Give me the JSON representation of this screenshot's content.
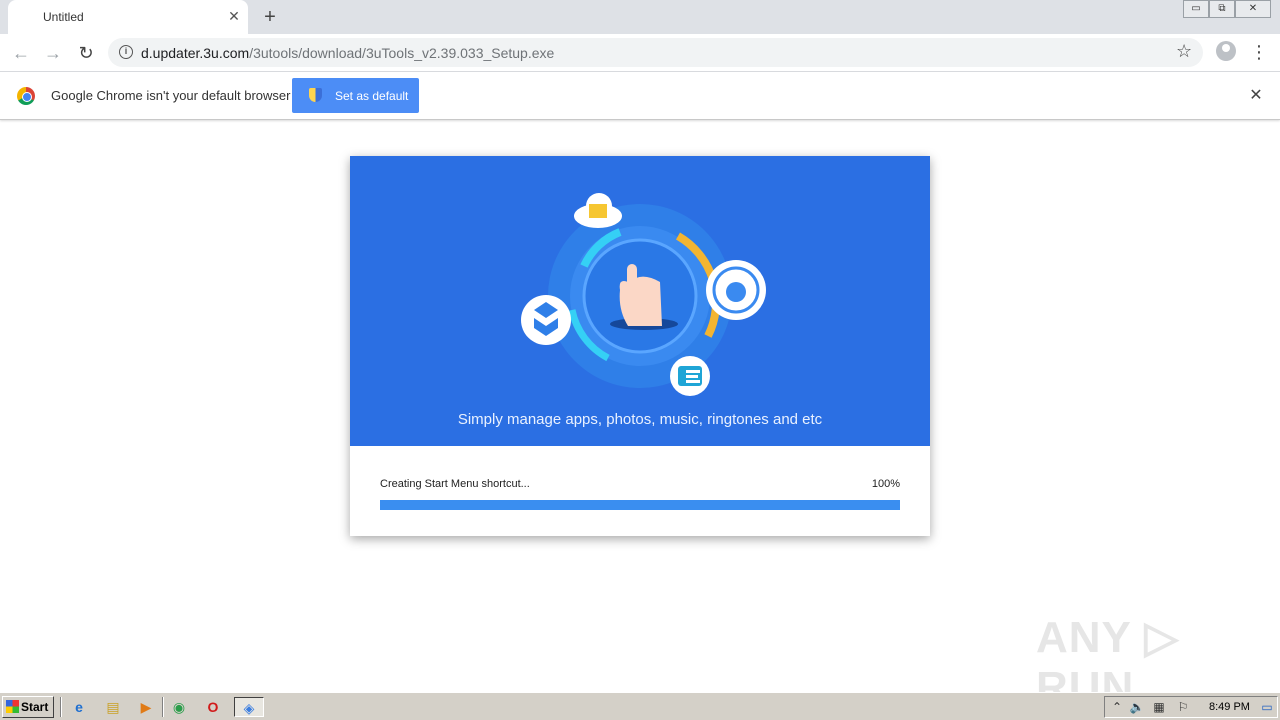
{
  "browser": {
    "tab": {
      "title": "Untitled",
      "close_glyph": "✕"
    },
    "new_tab_glyph": "+",
    "window_controls": [
      "▭",
      "⧉",
      "✕"
    ],
    "toolbar": {
      "back_glyph": "←",
      "forward_glyph": "→",
      "reload_glyph": "↻",
      "info_glyph": "i",
      "url_domain": "d.updater.3u.com",
      "url_path": "/3utools/download/3uTools_v2.39.033_Setup.exe",
      "star_glyph": "☆",
      "menu_glyph": "⋮"
    },
    "infobar": {
      "message": "Google Chrome isn't your default browser",
      "button_label": "Set as default",
      "close_glyph": "✕"
    }
  },
  "installer": {
    "tagline": "Simply manage apps, photos, music, ringtones and etc",
    "status_text": "Creating Start Menu shortcut...",
    "progress_label": "100%",
    "progress_fraction": 1.0,
    "colors": {
      "banner": "#2b6fe3",
      "progress": "#3a8ef0"
    },
    "icons": [
      "cloud-folder-icon",
      "hand-pointer-icon",
      "apple-sync-icon",
      "dropbox-box-icon",
      "e-app-icon"
    ]
  },
  "watermark": "ANY ▷ RUN",
  "taskbar": {
    "start_label": "Start",
    "apps": [
      {
        "name": "ie-icon",
        "glyph": "e"
      },
      {
        "name": "explorer-icon",
        "glyph": "▤"
      },
      {
        "name": "media-player-icon",
        "glyph": "▶"
      },
      {
        "name": "chrome-icon",
        "glyph": "◉"
      },
      {
        "name": "opera-icon",
        "glyph": "O"
      },
      {
        "name": "installer-icon",
        "glyph": "◈"
      }
    ],
    "tray": {
      "expand_glyph": "⌃",
      "volume_glyph": "🔈",
      "network_glyph": "▦",
      "flag_glyph": "⚐",
      "time": "8:49 PM",
      "desktop_glyph": "▭"
    }
  }
}
